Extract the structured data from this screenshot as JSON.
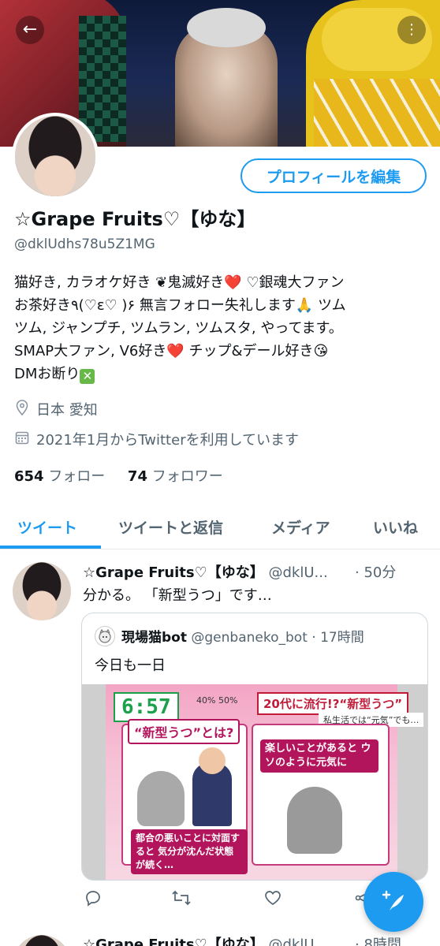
{
  "header": {
    "back_icon": "←",
    "more_icon": "⋮"
  },
  "profile": {
    "edit_button": "プロフィールを編集",
    "name": "☆Grape Fruits♡【ゆな】",
    "handle": "@dklUdhs78u5Z1MG",
    "bio_lines": [
      "猫好き, カラオケ好き  ❦鬼滅好き❤️ ♡銀魂大ファン",
      "お茶好き٩(♡ε♡ )۶  無言フォロー失礼します🙏 ツム",
      "ツム, ジャンプチ, ツムラン, ツムスタ, やってます。",
      "SMAP大ファン, V6好き❤️ チップ&デール好き😘",
      "DMお断り"
    ],
    "bio_cross": "✕",
    "location": "日本 愛知",
    "joined": "2021年1月からTwitterを利用しています",
    "following_count": "654",
    "following_label": "フォロー",
    "followers_count": "74",
    "followers_label": "フォロワー",
    "location_icon": "location-pin-icon",
    "calendar_icon": "calendar-icon"
  },
  "tabs": [
    {
      "label": "ツイート",
      "active": true
    },
    {
      "label": "ツイートと返信",
      "active": false
    },
    {
      "label": "メディア",
      "active": false
    },
    {
      "label": "いいね",
      "active": false
    }
  ],
  "tweet": {
    "name": "☆Grape Fruits♡【ゆな】",
    "handle": "@dklU...",
    "time": "· 50分",
    "text": "分かる。  「新型うつ」です…",
    "quote": {
      "name": "現場猫bot",
      "handle": "@genbaneko_bot",
      "time": "· 17時間",
      "text": "今日も一日",
      "image": {
        "clock": "6:57",
        "weather": "40% 50%",
        "topbar": "20代に流行!?“新型うつ”",
        "subbar": "私生活では“元気”でも…",
        "label_left": "“新型うつ”とは?",
        "label_right": "楽しいことがあると ウソのように元気に",
        "label_bottom": "都合の悪いことに対面すると 気分が沈んだ状態が続く…"
      }
    },
    "actions": {
      "reply": "💬",
      "retweet": "⟲",
      "like": "♡",
      "share": "⟨"
    }
  },
  "next_tweet": {
    "name": "☆Grape Fruits♡【ゆな】",
    "handle": "@dklU...",
    "time": "· 8時間"
  },
  "fab": {
    "icon": "+✎"
  }
}
